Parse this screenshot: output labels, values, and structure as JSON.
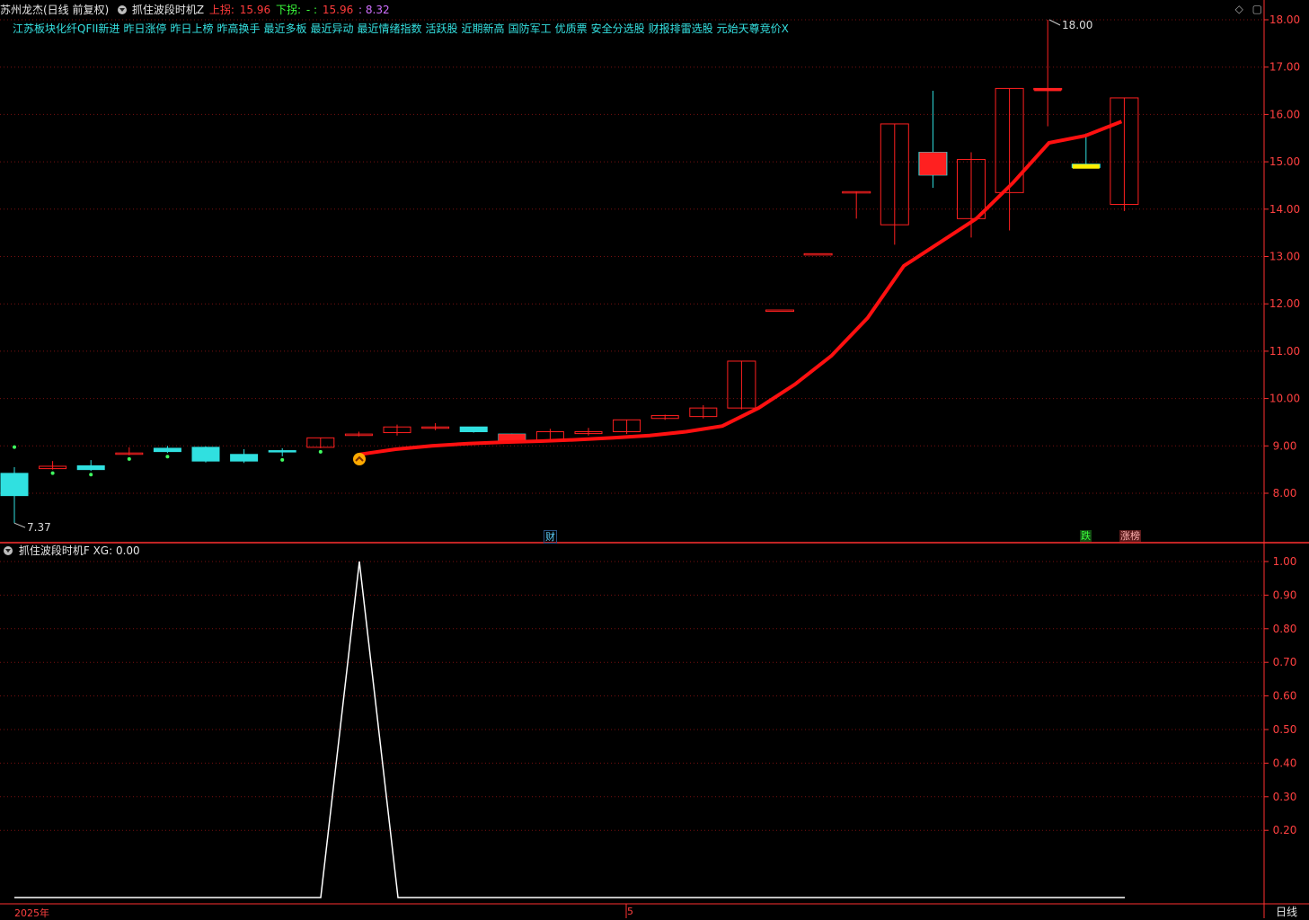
{
  "header": {
    "stock_title": "苏州龙杰(日线 前复权)",
    "indicator_name": "抓住波段时机Z",
    "upper_label": "上拐:",
    "upper_value": "15.96",
    "lower_label": "下拐:",
    "lower_value": "- :",
    "value3": "15.96",
    "value4": ": 8.32"
  },
  "concepts": [
    "江苏板块化纤QFII新进",
    "昨日涨停",
    "昨日上榜",
    "昨高换手",
    "最近多板",
    "最近异动",
    "最近情绪指数",
    "活跃股",
    "近期新高",
    "国防军工",
    "优质票",
    "安全分选股",
    "财报排雷选股",
    "元始天尊竞价X"
  ],
  "corner_icons": [
    "diamond-icon",
    "square-icon"
  ],
  "price_axis": [
    "18.00",
    "17.00",
    "16.00",
    "15.00",
    "14.00",
    "13.00",
    "12.00",
    "11.00",
    "10.00",
    "9.00",
    "8.00"
  ],
  "annotations": {
    "high": "18.00",
    "low": "7.37"
  },
  "tags": {
    "cai": "财",
    "die": "跌",
    "zhangbang": "涨榜"
  },
  "sub_panel": {
    "title": "抓住波段时机F",
    "xg_label": "XG:",
    "xg_value": "0.00",
    "axis": [
      "1.00",
      "0.90",
      "0.80",
      "0.70",
      "0.60",
      "0.50",
      "0.40",
      "0.30",
      "0.20"
    ]
  },
  "dates": {
    "start": "2025年",
    "mid": "5"
  },
  "period_button": "日线",
  "colors": {
    "up": "#ff2020",
    "down": "#30e0e0",
    "ma": "#ff1010",
    "axis": "#ff3030",
    "grid": "#7a1010"
  },
  "chart_data": [
    {
      "type": "candlestick",
      "title": "苏州龙杰(日线 前复权)",
      "ylim": [
        7.0,
        18.4
      ],
      "candles": [
        {
          "o": 8.42,
          "c": 7.95,
          "h": 8.55,
          "l": 7.37
        },
        {
          "o": 8.52,
          "c": 8.57,
          "h": 8.68,
          "l": 8.5
        },
        {
          "o": 8.58,
          "c": 8.5,
          "h": 8.7,
          "l": 8.47
        },
        {
          "o": 8.83,
          "c": 8.85,
          "h": 8.97,
          "l": 8.8
        },
        {
          "o": 8.95,
          "c": 8.88,
          "h": 9.0,
          "l": 8.85
        },
        {
          "o": 8.97,
          "c": 8.68,
          "h": 8.99,
          "l": 8.65
        },
        {
          "o": 8.82,
          "c": 8.68,
          "h": 8.93,
          "l": 8.64
        },
        {
          "o": 8.9,
          "c": 8.88,
          "h": 8.95,
          "l": 8.78
        },
        {
          "o": 8.97,
          "c": 9.17,
          "h": 9.17,
          "l": 8.95
        },
        {
          "o": 9.22,
          "c": 9.25,
          "h": 9.3,
          "l": 9.2
        },
        {
          "o": 9.28,
          "c": 9.4,
          "h": 9.45,
          "l": 9.22
        },
        {
          "o": 9.38,
          "c": 9.4,
          "h": 9.48,
          "l": 9.33
        },
        {
          "o": 9.4,
          "c": 9.3,
          "h": 9.4,
          "l": 9.28
        },
        {
          "o": 9.25,
          "c": 9.11,
          "h": 9.26,
          "l": 9.08
        },
        {
          "o": 9.12,
          "c": 9.3,
          "h": 9.36,
          "l": 9.1
        },
        {
          "o": 9.26,
          "c": 9.3,
          "h": 9.38,
          "l": 9.22
        },
        {
          "o": 9.3,
          "c": 9.55,
          "h": 9.55,
          "l": 9.25
        },
        {
          "o": 9.58,
          "c": 9.64,
          "h": 9.66,
          "l": 9.55
        },
        {
          "o": 9.62,
          "c": 9.8,
          "h": 9.86,
          "l": 9.58
        },
        {
          "o": 9.8,
          "c": 10.79,
          "h": 10.79,
          "l": 9.77
        },
        {
          "o": 11.87,
          "c": 11.87,
          "h": 11.87,
          "l": 11.87
        },
        {
          "o": 13.06,
          "c": 13.06,
          "h": 13.06,
          "l": 13.06
        },
        {
          "o": 14.37,
          "c": 14.37,
          "h": 14.37,
          "l": 13.8
        },
        {
          "o": 13.67,
          "c": 15.8,
          "h": 15.8,
          "l": 13.25
        },
        {
          "o": 15.2,
          "c": 14.72,
          "h": 16.5,
          "l": 14.45
        },
        {
          "o": 13.8,
          "c": 15.05,
          "h": 15.2,
          "l": 13.4
        },
        {
          "o": 14.35,
          "c": 16.55,
          "h": 16.55,
          "l": 13.55
        },
        {
          "o": 16.55,
          "c": 16.55,
          "h": 18.0,
          "l": 15.75
        },
        {
          "o": 14.95,
          "c": 14.88,
          "h": 15.6,
          "l": 14.88
        },
        {
          "o": 14.1,
          "c": 16.35,
          "h": 16.35,
          "l": 13.96
        }
      ],
      "ma": [
        null,
        null,
        null,
        null,
        null,
        null,
        null,
        null,
        null,
        8.82,
        8.93,
        9.0,
        9.05,
        9.08,
        9.1,
        9.13,
        9.17,
        9.22,
        9.3,
        9.42,
        9.8,
        10.3,
        10.9,
        11.7,
        12.8,
        13.3,
        13.8,
        14.55,
        15.4,
        15.55,
        15.85
      ],
      "ma_label": "15.96"
    },
    {
      "type": "line",
      "title": "抓住波段时机F",
      "series": [
        {
          "name": "XG",
          "values": [
            0,
            0,
            0,
            0,
            0,
            0,
            0,
            0,
            0,
            1,
            0,
            0,
            0,
            0,
            0,
            0,
            0,
            0,
            0,
            0,
            0,
            0,
            0,
            0,
            0,
            0,
            0,
            0,
            0,
            0
          ]
        }
      ],
      "ylim": [
        0,
        1.0
      ]
    }
  ]
}
